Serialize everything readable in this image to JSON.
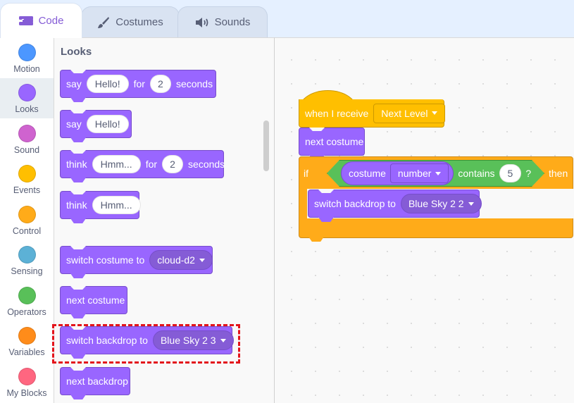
{
  "tabs": [
    {
      "label": "Code",
      "icon": "code-icon",
      "active": true
    },
    {
      "label": "Costumes",
      "icon": "brush-icon",
      "active": false
    },
    {
      "label": "Sounds",
      "icon": "speaker-icon",
      "active": false
    }
  ],
  "categories": [
    {
      "label": "Motion",
      "color": "#4c97ff"
    },
    {
      "label": "Looks",
      "color": "#9966ff",
      "selected": true
    },
    {
      "label": "Sound",
      "color": "#cf63cf"
    },
    {
      "label": "Events",
      "color": "#ffbf00"
    },
    {
      "label": "Control",
      "color": "#ffab19"
    },
    {
      "label": "Sensing",
      "color": "#5cb1d6"
    },
    {
      "label": "Operators",
      "color": "#59c059"
    },
    {
      "label": "Variables",
      "color": "#ff8c1a"
    },
    {
      "label": "My Blocks",
      "color": "#ff6680"
    }
  ],
  "palette": {
    "title": "Looks",
    "blocks": {
      "say_for": {
        "say": "say",
        "message": "Hello!",
        "for": "for",
        "secs": "2",
        "seconds": "seconds"
      },
      "say": {
        "say": "say",
        "message": "Hello!"
      },
      "think_for": {
        "think": "think",
        "message": "Hmm...",
        "for": "for",
        "secs": "2",
        "seconds": "seconds"
      },
      "think": {
        "think": "think",
        "message": "Hmm..."
      },
      "switch_costume": {
        "label": "switch costume to",
        "value": "cloud-d2"
      },
      "next_costume": {
        "label": "next costume"
      },
      "switch_backdrop": {
        "label": "switch backdrop to",
        "value": "Blue Sky 2 3"
      },
      "next_backdrop": {
        "label": "next backdrop"
      }
    }
  },
  "workspace": {
    "when_receive": {
      "label": "when I receive",
      "value": "Next Level"
    },
    "next_costume": {
      "label": "next costume"
    },
    "if_block": {
      "if": "if",
      "then": "then",
      "condition": {
        "reporter": "costume",
        "reporter_option": "number",
        "contains": "contains",
        "value": "5",
        "q": "?"
      }
    },
    "switch_backdrop": {
      "label": "switch backdrop to",
      "value": "Blue Sky 2 2"
    }
  },
  "colors": {
    "looks": "#9966ff",
    "events": "#ffbf00",
    "control": "#ffab19",
    "operators": "#59c059",
    "highlight": "#e3141b"
  }
}
